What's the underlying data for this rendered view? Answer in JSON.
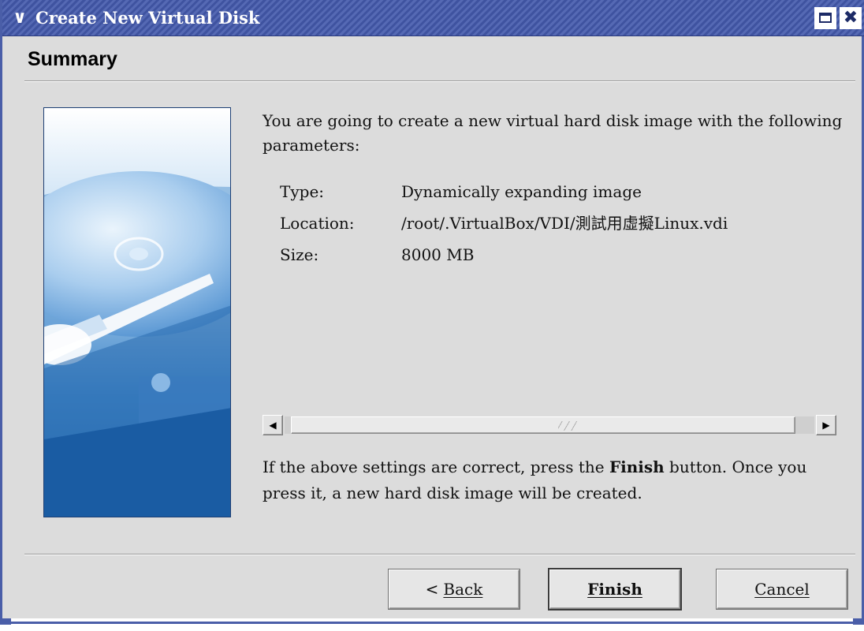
{
  "window": {
    "title": "Create New Virtual Disk",
    "menu_icon": "chevron-down-icon",
    "maximize_icon": "maximize-icon",
    "close_icon": "close-icon",
    "accent": "#4a5ea8"
  },
  "page": {
    "title": "Summary",
    "side_image": "hard-disk-illustration"
  },
  "summary": {
    "intro": "You are going to create a new virtual hard disk image with the following parameters:",
    "params": [
      {
        "label": "Type:",
        "value": "Dynamically expanding image"
      },
      {
        "label": "Location:",
        "value": "/root/.VirtualBox/VDI/測試用虛擬Linux.vdi"
      },
      {
        "label": "Size:",
        "value": "8000 MB"
      }
    ],
    "outro_before": "If the above settings are correct, press the ",
    "outro_bold": "Finish",
    "outro_after": " button. Once you press it, a new hard disk image will be created."
  },
  "scrollbar": {
    "left_icon": "arrow-left-icon",
    "right_icon": "arrow-right-icon"
  },
  "buttons": {
    "back": "Back",
    "finish": "Finish",
    "cancel": "Cancel"
  }
}
